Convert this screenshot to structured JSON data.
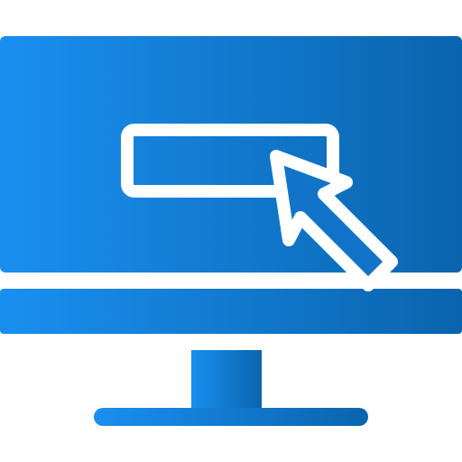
{
  "icon": {
    "name": "computer-click-icon",
    "parts": [
      "monitor-screen-icon",
      "input-field-icon",
      "cursor-arrow-icon",
      "monitor-stand-icon"
    ]
  },
  "colors": {
    "gradient_start": "#1a8ff0",
    "gradient_end": "#0a64ad",
    "outline": "#ffffff",
    "background": "#ffffff"
  }
}
